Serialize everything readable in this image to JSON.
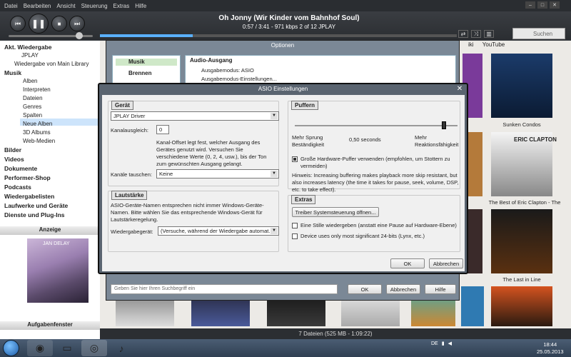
{
  "menu": [
    "Datei",
    "Bearbeiten",
    "Ansicht",
    "Steuerung",
    "Extras",
    "Hilfe"
  ],
  "player": {
    "title": "Oh Jonny (Wir Kinder vom Bahnhof Soul)",
    "info": "0:57 / 3:41 - 971 kbps  2 of 12  JPLAY",
    "search_placeholder": "Suchen",
    "progress": 0.26
  },
  "sidebar": {
    "nowplaying_header": "Akt. Wiedergabe",
    "nowplaying_items": [
      "JPLAY",
      "Wiedergabe von Main Library"
    ],
    "music_header": "Musik",
    "music_items": [
      "Alben",
      "Interpreten",
      "Dateien",
      "Genres",
      "Spalten",
      "Neue Alben",
      "3D Albums",
      "Web-Medien"
    ],
    "sections": [
      "Bilder",
      "Videos",
      "Dokumente",
      "Performer-Shop",
      "Podcasts",
      "Wiedergabelisten",
      "Laufwerke und Geräte",
      "Dienste und Plug-Ins"
    ],
    "anzeige": "Anzeige",
    "aufgaben": "Aufgabenfenster",
    "album_text": "JAN DELAY"
  },
  "background": {
    "tab_youtube": "YouTube",
    "tab_wiki": "iki",
    "albums": [
      "Sunken Condos",
      "The Best of Eric Clapton - The",
      "The Last in Line"
    ],
    "clapton_cover_text": "ERIC CLAPTON",
    "status": "7 Dateien (525 MB - 1:09:22)"
  },
  "optionen": {
    "title": "Optionen",
    "nav": [
      "Musik",
      "Brennen"
    ],
    "tree_header": "Audio-Ausgang",
    "tree_items": [
      "Ausgabemodus: ASIO",
      "Ausgabemodus-Einstellungen..."
    ],
    "search_placeholder": "Geben Sie hier Ihren Suchbegriff ein",
    "ok": "OK",
    "cancel": "Abbrechen",
    "help": "Hilfe"
  },
  "asio": {
    "title": "ASIO Einstellungen",
    "device_header": "Gerät",
    "device_value": "JPLAY Driver",
    "channel_offset_label": "Kanalausgleich:",
    "channel_offset_value": "0",
    "channel_offset_desc": "Kanal-Offset legt fest, welcher Ausgang des Gerätes genutzt wird. Versuchen Sie verschiedene Werte (0, 2, 4, usw.), bis der Ton zum gewünschten Ausgang gelangt.",
    "swap_label": "Kanäle tauschen:",
    "swap_value": "Keine",
    "volume_header": "Lautstärke",
    "volume_desc": "ASIO-Geräte-Namen entsprechen nicht immer Windows-Geräte-Namen. Bitte wählen Sie das entsprechende Windows-Gerät für Lautstärkeregelung.",
    "playback_label": "Wiedergabegerät:",
    "playback_value": "(Versuche, während der Wiedergabe automat...",
    "buffer_header": "Puffern",
    "buffer_left": "Mehr Sprung Beständigkeit",
    "buffer_value": "0,50 seconds",
    "buffer_right": "Mehr Reaktionsfähigkeit",
    "hw_buffer": "Große Hardware-Puffer verwenden (empfohlen, um Stottern zu vermeiden)",
    "hint": "Hinweis: Increasing buffering makes playback more skip resistant, but also increases latency (the time it takes for pause, seek, volume, DSP, etc. to take effect).",
    "extras_header": "Extras",
    "driver_button": "Treiber Systemsteuerung öffnen...",
    "silence": "Eine Stille wiedergeben (anstatt eine Pause auf Hardware-Ebene)",
    "msb": "Device uses only most significant 24-bits (Lynx, etc.)",
    "ok": "OK",
    "cancel": "Abbrechen"
  },
  "taskbar": {
    "lang": "DE",
    "time": "18:44",
    "date": "25.05.2013"
  }
}
